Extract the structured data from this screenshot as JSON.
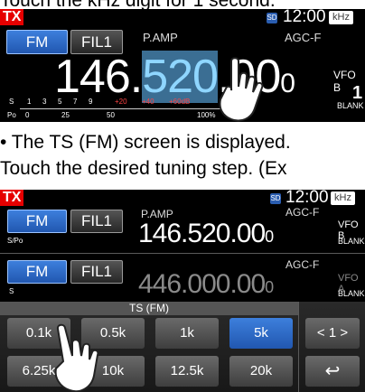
{
  "caption_top": "Touch the kHz digit for 1 second.",
  "caption_note": "• The TS (FM) screen is displayed.",
  "caption_step": "Touch the desired tuning step. (Ex",
  "screen1": {
    "tx": "TX",
    "sd": "SD",
    "clock": "12:00",
    "khz": "kHz",
    "mode": "FM",
    "filter": "FIL1",
    "pamp": "P.AMP",
    "agc": "AGC-F",
    "freq_main": "146.",
    "freq_hl": "520",
    "freq_tail": ".00",
    "freq_small": "0",
    "vfo": "VFO B",
    "vfo_num": "1",
    "blank": "BLANK",
    "s_label": "S",
    "po_label": "Po",
    "s_scale": [
      "1",
      "3",
      "5",
      "7",
      "9",
      "+20",
      "+40",
      "+60dB"
    ],
    "po_scale": [
      "0",
      "25",
      "50",
      "100%"
    ]
  },
  "screen2": {
    "tx": "TX",
    "sd": "SD",
    "clock": "12:00",
    "khz": "kHz",
    "main": {
      "mode": "FM",
      "filter": "FIL1",
      "pamp": "P.AMP",
      "agc": "AGC-F",
      "freq": "146.520.00",
      "freq_small": "0",
      "vfo": "VFO B",
      "vfo_num": "1",
      "blank": "BLANK",
      "meter_label": "S/Po"
    },
    "sub": {
      "mode": "FM",
      "filter": "FIL1",
      "agc": "AGC-F",
      "freq": "446.000.00",
      "freq_small": "0",
      "vfo": "VFO A",
      "vfo_num": "1",
      "blank": "BLANK",
      "meter_label": "S"
    },
    "ts_title": "TS (FM)",
    "steps_row1": [
      "0.1k",
      "0.5k",
      "1k",
      "5k"
    ],
    "steps_row2": [
      "6.25k",
      "10k",
      "12.5k",
      "20k"
    ],
    "selected_step": "5k",
    "nav_label": "< 1 >",
    "back_symbol": "↩"
  },
  "colors": {
    "accent_blue": "#2a62c4",
    "tx_red": "#e60000",
    "freq_highlight": "#8fd6ff"
  }
}
